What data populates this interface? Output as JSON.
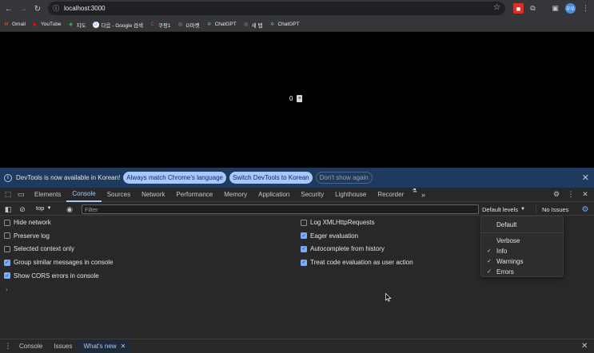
{
  "browser": {
    "url": "localhost:3000",
    "bookmarks": [
      {
        "label": "Gmail",
        "icon": "gmail-icon",
        "color": "#ea4335",
        "glyph": "M"
      },
      {
        "label": "YouTube",
        "icon": "youtube-icon",
        "color": "#ff0000",
        "glyph": "▶"
      },
      {
        "label": "지도",
        "icon": "maps-icon",
        "color": "#34a853",
        "glyph": "◆"
      },
      {
        "label": "다음 - Google 검색",
        "icon": "google-icon",
        "color": "#ffffff",
        "glyph": "G"
      },
      {
        "label": "쿠팡1",
        "icon": "coupang-icon",
        "color": "#e53935",
        "glyph": "C"
      },
      {
        "label": "G마켓",
        "icon": "globe-icon",
        "color": "#9aa0a6",
        "glyph": "◎"
      },
      {
        "label": "ChatGPT",
        "icon": "chatgpt-icon",
        "color": "#74aa9c",
        "glyph": "✲"
      },
      {
        "label": "새 탭",
        "icon": "globe-icon",
        "color": "#9aa0a6",
        "glyph": "◎"
      },
      {
        "label": "ChatGPT",
        "icon": "chatgpt-icon",
        "color": "#74aa9c",
        "glyph": "✲"
      }
    ],
    "avatar_initials": "우우"
  },
  "page": {
    "counter_value": "0",
    "increment_label": "+"
  },
  "devtools": {
    "infobar": {
      "message": "DevTools is now available in Korean!",
      "button_match": "Always match Chrome's language",
      "button_switch": "Switch DevTools to Korean",
      "button_dismiss": "Don't show again"
    },
    "tabs": [
      "Elements",
      "Console",
      "Sources",
      "Network",
      "Performance",
      "Memory",
      "Application",
      "Security",
      "Lighthouse",
      "Recorder"
    ],
    "active_tab": "Console",
    "toolbar": {
      "context": "top",
      "filter_placeholder": "Filter",
      "levels": "Default levels",
      "issues": "No Issues"
    },
    "settings_left": [
      {
        "label": "Hide network",
        "checked": false
      },
      {
        "label": "Preserve log",
        "checked": false
      },
      {
        "label": "Selected context only",
        "checked": false
      },
      {
        "label": "Group similar messages in console",
        "checked": true
      },
      {
        "label": "Show CORS errors in console",
        "checked": true
      }
    ],
    "settings_right": [
      {
        "label": "Log XMLHttpRequests",
        "checked": false
      },
      {
        "label": "Eager evaluation",
        "checked": true
      },
      {
        "label": "Autocomplete from history",
        "checked": true
      },
      {
        "label": "Treat code evaluation as user action",
        "checked": true
      }
    ],
    "prompt": "›",
    "levels_menu": {
      "default": "Default",
      "items": [
        {
          "label": "Verbose",
          "checked": false
        },
        {
          "label": "Info",
          "checked": true
        },
        {
          "label": "Warnings",
          "checked": true
        },
        {
          "label": "Errors",
          "checked": true
        }
      ]
    },
    "drawer": {
      "tabs": [
        "Console",
        "Issues",
        "What's new"
      ],
      "active": "What's new"
    }
  },
  "colors": {
    "accent": "#a8c7fa",
    "checkbox": "#7cacf8",
    "infobar": "#1e3a5f"
  }
}
